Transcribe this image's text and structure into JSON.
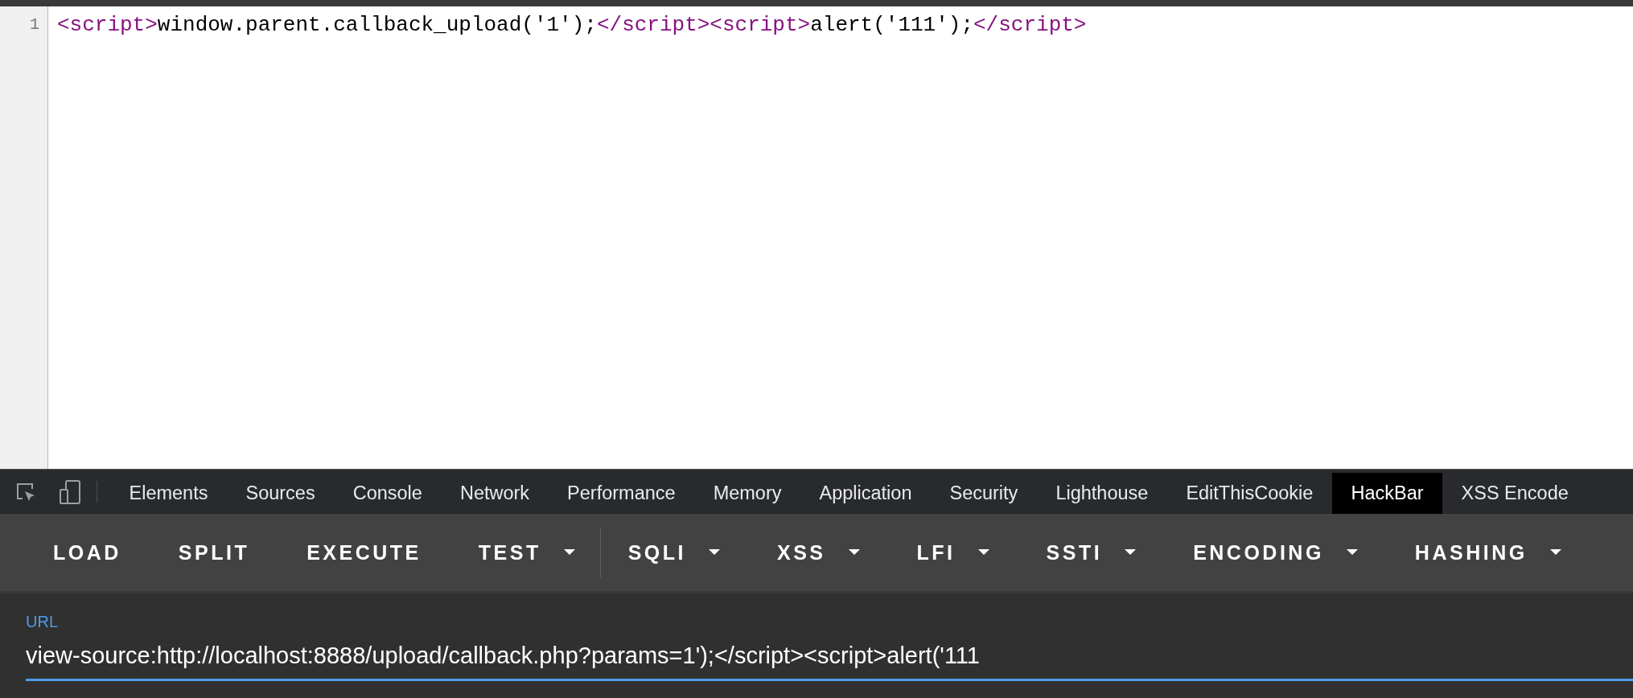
{
  "source_view": {
    "lines": [
      {
        "number": "1",
        "tokens": [
          {
            "kind": "tag",
            "text": "<script>"
          },
          {
            "kind": "text",
            "text": "window.parent.callback_upload('1');"
          },
          {
            "kind": "tag",
            "text": "</script><script>"
          },
          {
            "kind": "text",
            "text": "alert('111');"
          },
          {
            "kind": "tag",
            "text": "</script>"
          }
        ]
      }
    ]
  },
  "devtools": {
    "tabs": [
      {
        "label": "Elements",
        "selected": false
      },
      {
        "label": "Sources",
        "selected": false
      },
      {
        "label": "Console",
        "selected": false
      },
      {
        "label": "Network",
        "selected": false
      },
      {
        "label": "Performance",
        "selected": false
      },
      {
        "label": "Memory",
        "selected": false
      },
      {
        "label": "Application",
        "selected": false
      },
      {
        "label": "Security",
        "selected": false
      },
      {
        "label": "Lighthouse",
        "selected": false
      },
      {
        "label": "EditThisCookie",
        "selected": false
      },
      {
        "label": "HackBar",
        "selected": true
      },
      {
        "label": "XSS Encode",
        "selected": false
      }
    ]
  },
  "hackbar": {
    "buttons": [
      {
        "kind": "button",
        "label": "LOAD"
      },
      {
        "kind": "button",
        "label": "SPLIT"
      },
      {
        "kind": "button",
        "label": "EXECUTE"
      },
      {
        "kind": "dropdown",
        "label": "TEST"
      },
      {
        "kind": "divider"
      },
      {
        "kind": "dropdown",
        "label": "SQLI"
      },
      {
        "kind": "dropdown",
        "label": "XSS"
      },
      {
        "kind": "dropdown",
        "label": "LFI"
      },
      {
        "kind": "dropdown",
        "label": "SSTI"
      },
      {
        "kind": "dropdown",
        "label": "ENCODING"
      },
      {
        "kind": "dropdown",
        "label": "HASHING"
      }
    ],
    "url_field": {
      "label": "URL",
      "value": "view-source:http://localhost:8888/upload/callback.php?params=1');</script><script>alert('111"
    }
  }
}
